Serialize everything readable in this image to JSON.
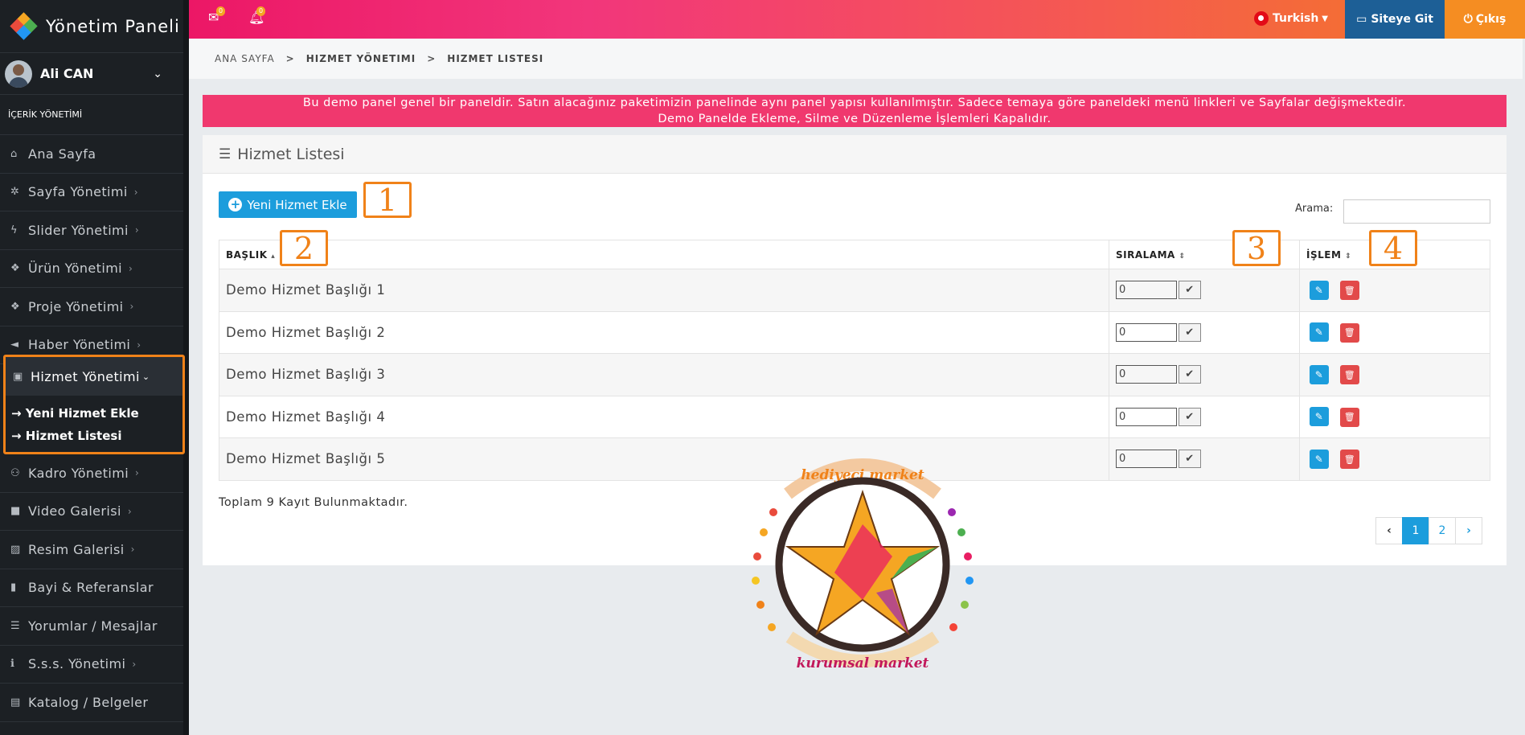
{
  "brand": {
    "title": "Yönetim Paneli"
  },
  "user": {
    "name": "Ali CAN"
  },
  "sidebar": {
    "section_title": "İÇERİK YÖNETİMİ",
    "items": [
      {
        "label": "Ana Sayfa",
        "icon": "home-icon"
      },
      {
        "label": "Sayfa Yönetimi",
        "icon": "leaf-icon"
      },
      {
        "label": "Slider Yönetimi",
        "icon": "bolt-icon"
      },
      {
        "label": "Ürün Yönetimi",
        "icon": "cubes-icon"
      },
      {
        "label": "Proje Yönetimi",
        "icon": "cubes-icon"
      },
      {
        "label": "Haber Yönetimi",
        "icon": "bullhorn-icon"
      },
      {
        "label": "Hizmet Yönetimi",
        "icon": "briefcase-icon"
      },
      {
        "label": "Kadro Yönetimi",
        "icon": "users-icon"
      },
      {
        "label": "Video Galerisi",
        "icon": "video-camera-icon"
      },
      {
        "label": "Resim Galerisi",
        "icon": "image-icon"
      },
      {
        "label": "Bayi & Referanslar",
        "icon": "bookmark-icon"
      },
      {
        "label": "Yorumlar / Mesajlar",
        "icon": "list-icon"
      },
      {
        "label": "S.s.s. Yönetimi",
        "icon": "info-icon"
      },
      {
        "label": "Katalog / Belgeler",
        "icon": "book-icon"
      }
    ],
    "submenu": [
      "Yeni Hizmet Ekle",
      "Hizmet Listesi"
    ]
  },
  "topbar": {
    "mail_count": "0",
    "bell_count": "0",
    "language": "Turkish",
    "site_button": "Siteye Git",
    "exit_button": "Çıkış",
    "accent_colors": {
      "site": "#1d5f96",
      "exit": "#f58d22"
    }
  },
  "breadcrumb": [
    "ANA SAYFA",
    "HIZMET YÖNETIMI",
    "HIZMET LISTESI"
  ],
  "notice": {
    "line1": "Bu demo panel genel bir paneldir. Satın alacağınız paketimizin panelinde aynı panel yapısı kullanılmıştır. Sadece temaya göre paneldeki menü linkleri ve Sayfalar değişmektedir.",
    "line2": "Demo Panelde Ekleme, Silme ve Düzenleme İşlemleri Kapalıdır."
  },
  "card": {
    "title": "Hizmet Listesi",
    "add_button": "Yeni Hizmet Ekle",
    "search_label": "Arama:",
    "search_value": "",
    "columns": [
      "BAŞLIK",
      "SIRALAMA",
      "İŞLEM"
    ],
    "rows": [
      {
        "title": "Demo Hizmet Başlığı 1",
        "order": "0"
      },
      {
        "title": "Demo Hizmet Başlığı 2",
        "order": "0"
      },
      {
        "title": "Demo Hizmet Başlığı 3",
        "order": "0"
      },
      {
        "title": "Demo Hizmet Başlığı 4",
        "order": "0"
      },
      {
        "title": "Demo Hizmet Başlığı 5",
        "order": "0"
      }
    ],
    "total_text": "Toplam 9 Kayıt Bulunmaktadır.",
    "pages": [
      "1",
      "2"
    ],
    "current_page": "1"
  },
  "callouts": [
    "1",
    "2",
    "3",
    "4"
  ],
  "watermark": {
    "top_text": "hediyeci market",
    "bottom_text": "kurumsal market"
  }
}
